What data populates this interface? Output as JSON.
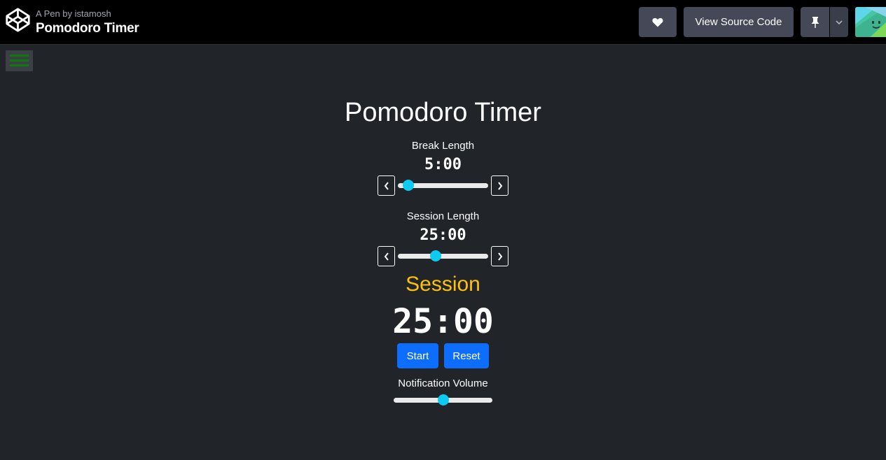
{
  "header": {
    "byline": "A Pen by istamosh",
    "pen_title": "Pomodoro Timer",
    "heart_icon": "heart-icon",
    "view_source_label": "View Source Code",
    "pin_icon": "pin-icon",
    "dropdown_icon": "chevron-down-icon",
    "logo_icon": "codepen-logo-icon"
  },
  "menu": {
    "icon": "hamburger-menu-icon",
    "color": "#0b7a0b"
  },
  "app": {
    "title": "Pomodoro Timer",
    "break": {
      "label": "Break Length",
      "value": "5:00",
      "slider_fraction": 0.12,
      "decrement": "‹",
      "increment": "›"
    },
    "session": {
      "label": "Session Length",
      "value": "25:00",
      "slider_fraction": 0.42,
      "decrement": "‹",
      "increment": "›"
    },
    "mode_label": "Session",
    "timer_display": "25:00",
    "start_label": "Start",
    "reset_label": "Reset",
    "volume": {
      "label": "Notification Volume",
      "slider_fraction": 0.5
    },
    "colors": {
      "accent": "#0dcaf0",
      "mode": "#ffc107",
      "button": "#0d6efd",
      "background": "#212429"
    }
  }
}
